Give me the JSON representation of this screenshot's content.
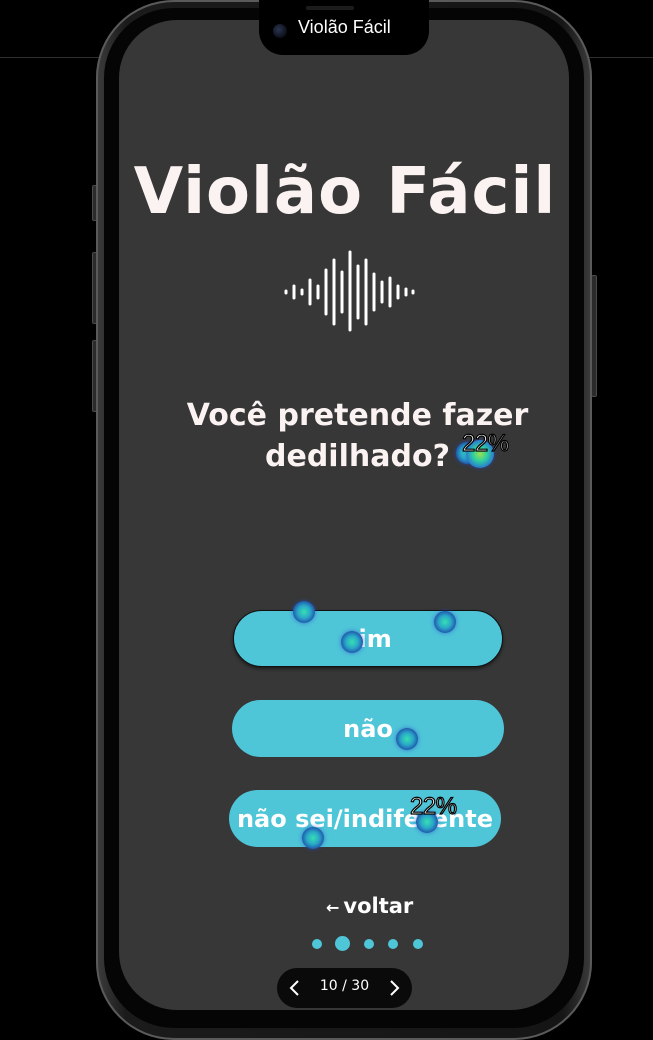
{
  "window": {
    "title": "Violão Fácil"
  },
  "app": {
    "title": "Violão Fácil",
    "icon": "sound-wave-icon"
  },
  "question": {
    "text": "Você pretende fazer dedilhado?"
  },
  "answers": [
    {
      "label": "sim"
    },
    {
      "label": "não"
    },
    {
      "label": "não sei/indiferente"
    }
  ],
  "back": {
    "arrow": "←",
    "label": "voltar"
  },
  "progress_dots": {
    "count": 5,
    "active_index": 1
  },
  "pager": {
    "text": "10 / 30"
  },
  "heatmap": {
    "labels": [
      "22%",
      "22%"
    ]
  },
  "colors": {
    "accent": "#4fc5d8",
    "screen_bg": "#373737",
    "title": "#fbf3f2"
  }
}
